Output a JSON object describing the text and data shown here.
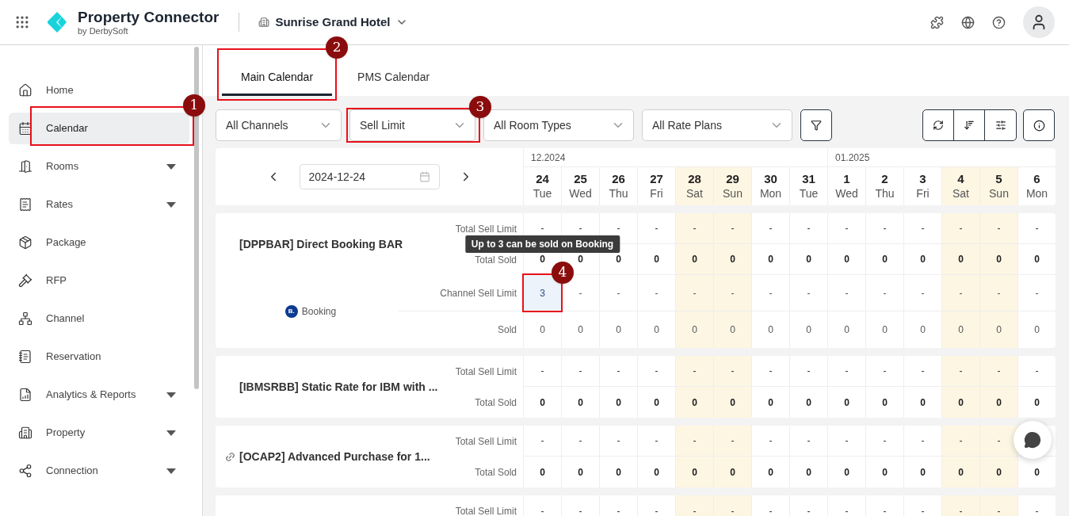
{
  "header": {
    "app_title": "Property Connector",
    "app_subtitle": "by DerbySoft",
    "property": "Sunrise Grand Hotel"
  },
  "sidebar": {
    "items": [
      {
        "label": "Home",
        "selected": false,
        "has_submenu": false
      },
      {
        "label": "Calendar",
        "selected": true,
        "has_submenu": false,
        "annotation": "1"
      },
      {
        "label": "Rooms",
        "selected": false,
        "has_submenu": true
      },
      {
        "label": "Rates",
        "selected": false,
        "has_submenu": true
      },
      {
        "label": "Package",
        "selected": false,
        "has_submenu": false
      },
      {
        "label": "RFP",
        "selected": false,
        "has_submenu": false
      },
      {
        "label": "Channel",
        "selected": false,
        "has_submenu": false
      },
      {
        "label": "Reservation",
        "selected": false,
        "has_submenu": false
      },
      {
        "label": "Analytics & Reports",
        "selected": false,
        "has_submenu": true
      },
      {
        "label": "Property",
        "selected": false,
        "has_submenu": true
      },
      {
        "label": "Connection",
        "selected": false,
        "has_submenu": true
      }
    ]
  },
  "tabs": [
    {
      "label": "Main Calendar",
      "selected": true,
      "annotation": "2"
    },
    {
      "label": "PMS Calendar",
      "selected": false
    }
  ],
  "filters": [
    {
      "value": "All Channels"
    },
    {
      "value": "Sell Limit",
      "annotation": "3"
    },
    {
      "value": "All Room Types"
    },
    {
      "value": "All Rate Plans"
    }
  ],
  "date_field": {
    "value": "2024-12-24"
  },
  "months": [
    {
      "label": "12.2024"
    },
    {
      "label": "01.2025"
    }
  ],
  "days": [
    {
      "date": "24",
      "weekday": "Tue",
      "weekend": false
    },
    {
      "date": "25",
      "weekday": "Wed",
      "weekend": false
    },
    {
      "date": "26",
      "weekday": "Thu",
      "weekend": false
    },
    {
      "date": "27",
      "weekday": "Fri",
      "weekend": false
    },
    {
      "date": "28",
      "weekday": "Sat",
      "weekend": true
    },
    {
      "date": "29",
      "weekday": "Sun",
      "weekend": true
    },
    {
      "date": "30",
      "weekday": "Mon",
      "weekend": false
    },
    {
      "date": "31",
      "weekday": "Tue",
      "weekend": false
    },
    {
      "date": "1",
      "weekday": "Wed",
      "weekend": false
    },
    {
      "date": "2",
      "weekday": "Thu",
      "weekend": false
    },
    {
      "date": "3",
      "weekday": "Fri",
      "weekend": false
    },
    {
      "date": "4",
      "weekday": "Sat",
      "weekend": true
    },
    {
      "date": "5",
      "weekday": "Sun",
      "weekend": true
    },
    {
      "date": "6",
      "weekday": "Mon",
      "weekend": false
    }
  ],
  "rate_plans": [
    {
      "name": "[DPPBAR] Direct Booking BAR",
      "linked": false,
      "rows": [
        {
          "label": "Total Sell Limit",
          "bold": false,
          "values": [
            "-",
            "-",
            "-",
            "-",
            "-",
            "-",
            "-",
            "-",
            "-",
            "-",
            "-",
            "-",
            "-",
            "-"
          ]
        },
        {
          "label": "Total Sold",
          "bold": true,
          "values": [
            "0",
            "0",
            "0",
            "0",
            "0",
            "0",
            "0",
            "0",
            "0",
            "0",
            "0",
            "0",
            "0",
            "0"
          ]
        }
      ],
      "channel": {
        "name": "Booking",
        "logo": "B.",
        "rows": [
          {
            "label": "Channel Sell Limit",
            "cells": [
              {
                "text": "3",
                "selected": true,
                "annotation": "4",
                "tooltip": "Up to 3 can be sold on Booking"
              },
              {
                "text": "-",
                "selected": false
              },
              {
                "text": "-",
                "selected": false
              },
              {
                "text": "-",
                "selected": false
              },
              {
                "text": "-",
                "selected": false
              },
              {
                "text": "-",
                "selected": false
              },
              {
                "text": "-",
                "selected": false
              },
              {
                "text": "-",
                "selected": false
              },
              {
                "text": "-",
                "selected": false
              },
              {
                "text": "-",
                "selected": false
              },
              {
                "text": "-",
                "selected": false
              },
              {
                "text": "-",
                "selected": false
              },
              {
                "text": "-",
                "selected": false
              },
              {
                "text": "-",
                "selected": false
              }
            ]
          },
          {
            "label": "Sold",
            "cells": [
              {
                "text": "0",
                "selected": false
              },
              {
                "text": "0",
                "selected": false
              },
              {
                "text": "0",
                "selected": false
              },
              {
                "text": "0",
                "selected": false
              },
              {
                "text": "0",
                "selected": false
              },
              {
                "text": "0",
                "selected": false
              },
              {
                "text": "0",
                "selected": false
              },
              {
                "text": "0",
                "selected": false
              },
              {
                "text": "0",
                "selected": false
              },
              {
                "text": "0",
                "selected": false
              },
              {
                "text": "0",
                "selected": false
              },
              {
                "text": "0",
                "selected": false
              },
              {
                "text": "0",
                "selected": false
              },
              {
                "text": "0",
                "selected": false
              }
            ]
          }
        ]
      }
    },
    {
      "name": "[IBMSRBB] Static Rate for IBM with ...",
      "linked": false,
      "rows": [
        {
          "label": "Total Sell Limit",
          "bold": false,
          "values": [
            "-",
            "-",
            "-",
            "-",
            "-",
            "-",
            "-",
            "-",
            "-",
            "-",
            "-",
            "-",
            "-",
            "-"
          ]
        },
        {
          "label": "Total Sold",
          "bold": true,
          "values": [
            "0",
            "0",
            "0",
            "0",
            "0",
            "0",
            "0",
            "0",
            "0",
            "0",
            "0",
            "0",
            "0",
            "0"
          ]
        }
      ]
    },
    {
      "name": "[OCAP2] Advanced Purchase for 1...",
      "linked": true,
      "rows": [
        {
          "label": "Total Sell Limit",
          "bold": false,
          "values": [
            "-",
            "-",
            "-",
            "-",
            "-",
            "-",
            "-",
            "-",
            "-",
            "-",
            "-",
            "-",
            "-"
          ]
        },
        {
          "label": "Total Sold",
          "bold": true,
          "values": [
            "0",
            "0",
            "0",
            "0",
            "0",
            "0",
            "0",
            "0",
            "0",
            "0",
            "0",
            "0",
            "0",
            "0"
          ]
        }
      ]
    },
    {
      "rows": [
        {
          "label": "Total Sell Limit",
          "bold": false,
          "values": [
            "-",
            "-",
            "-",
            "-",
            "-",
            "-",
            "-",
            "-",
            "-",
            "-",
            "-",
            "-",
            "-",
            "-"
          ]
        }
      ]
    }
  ]
}
